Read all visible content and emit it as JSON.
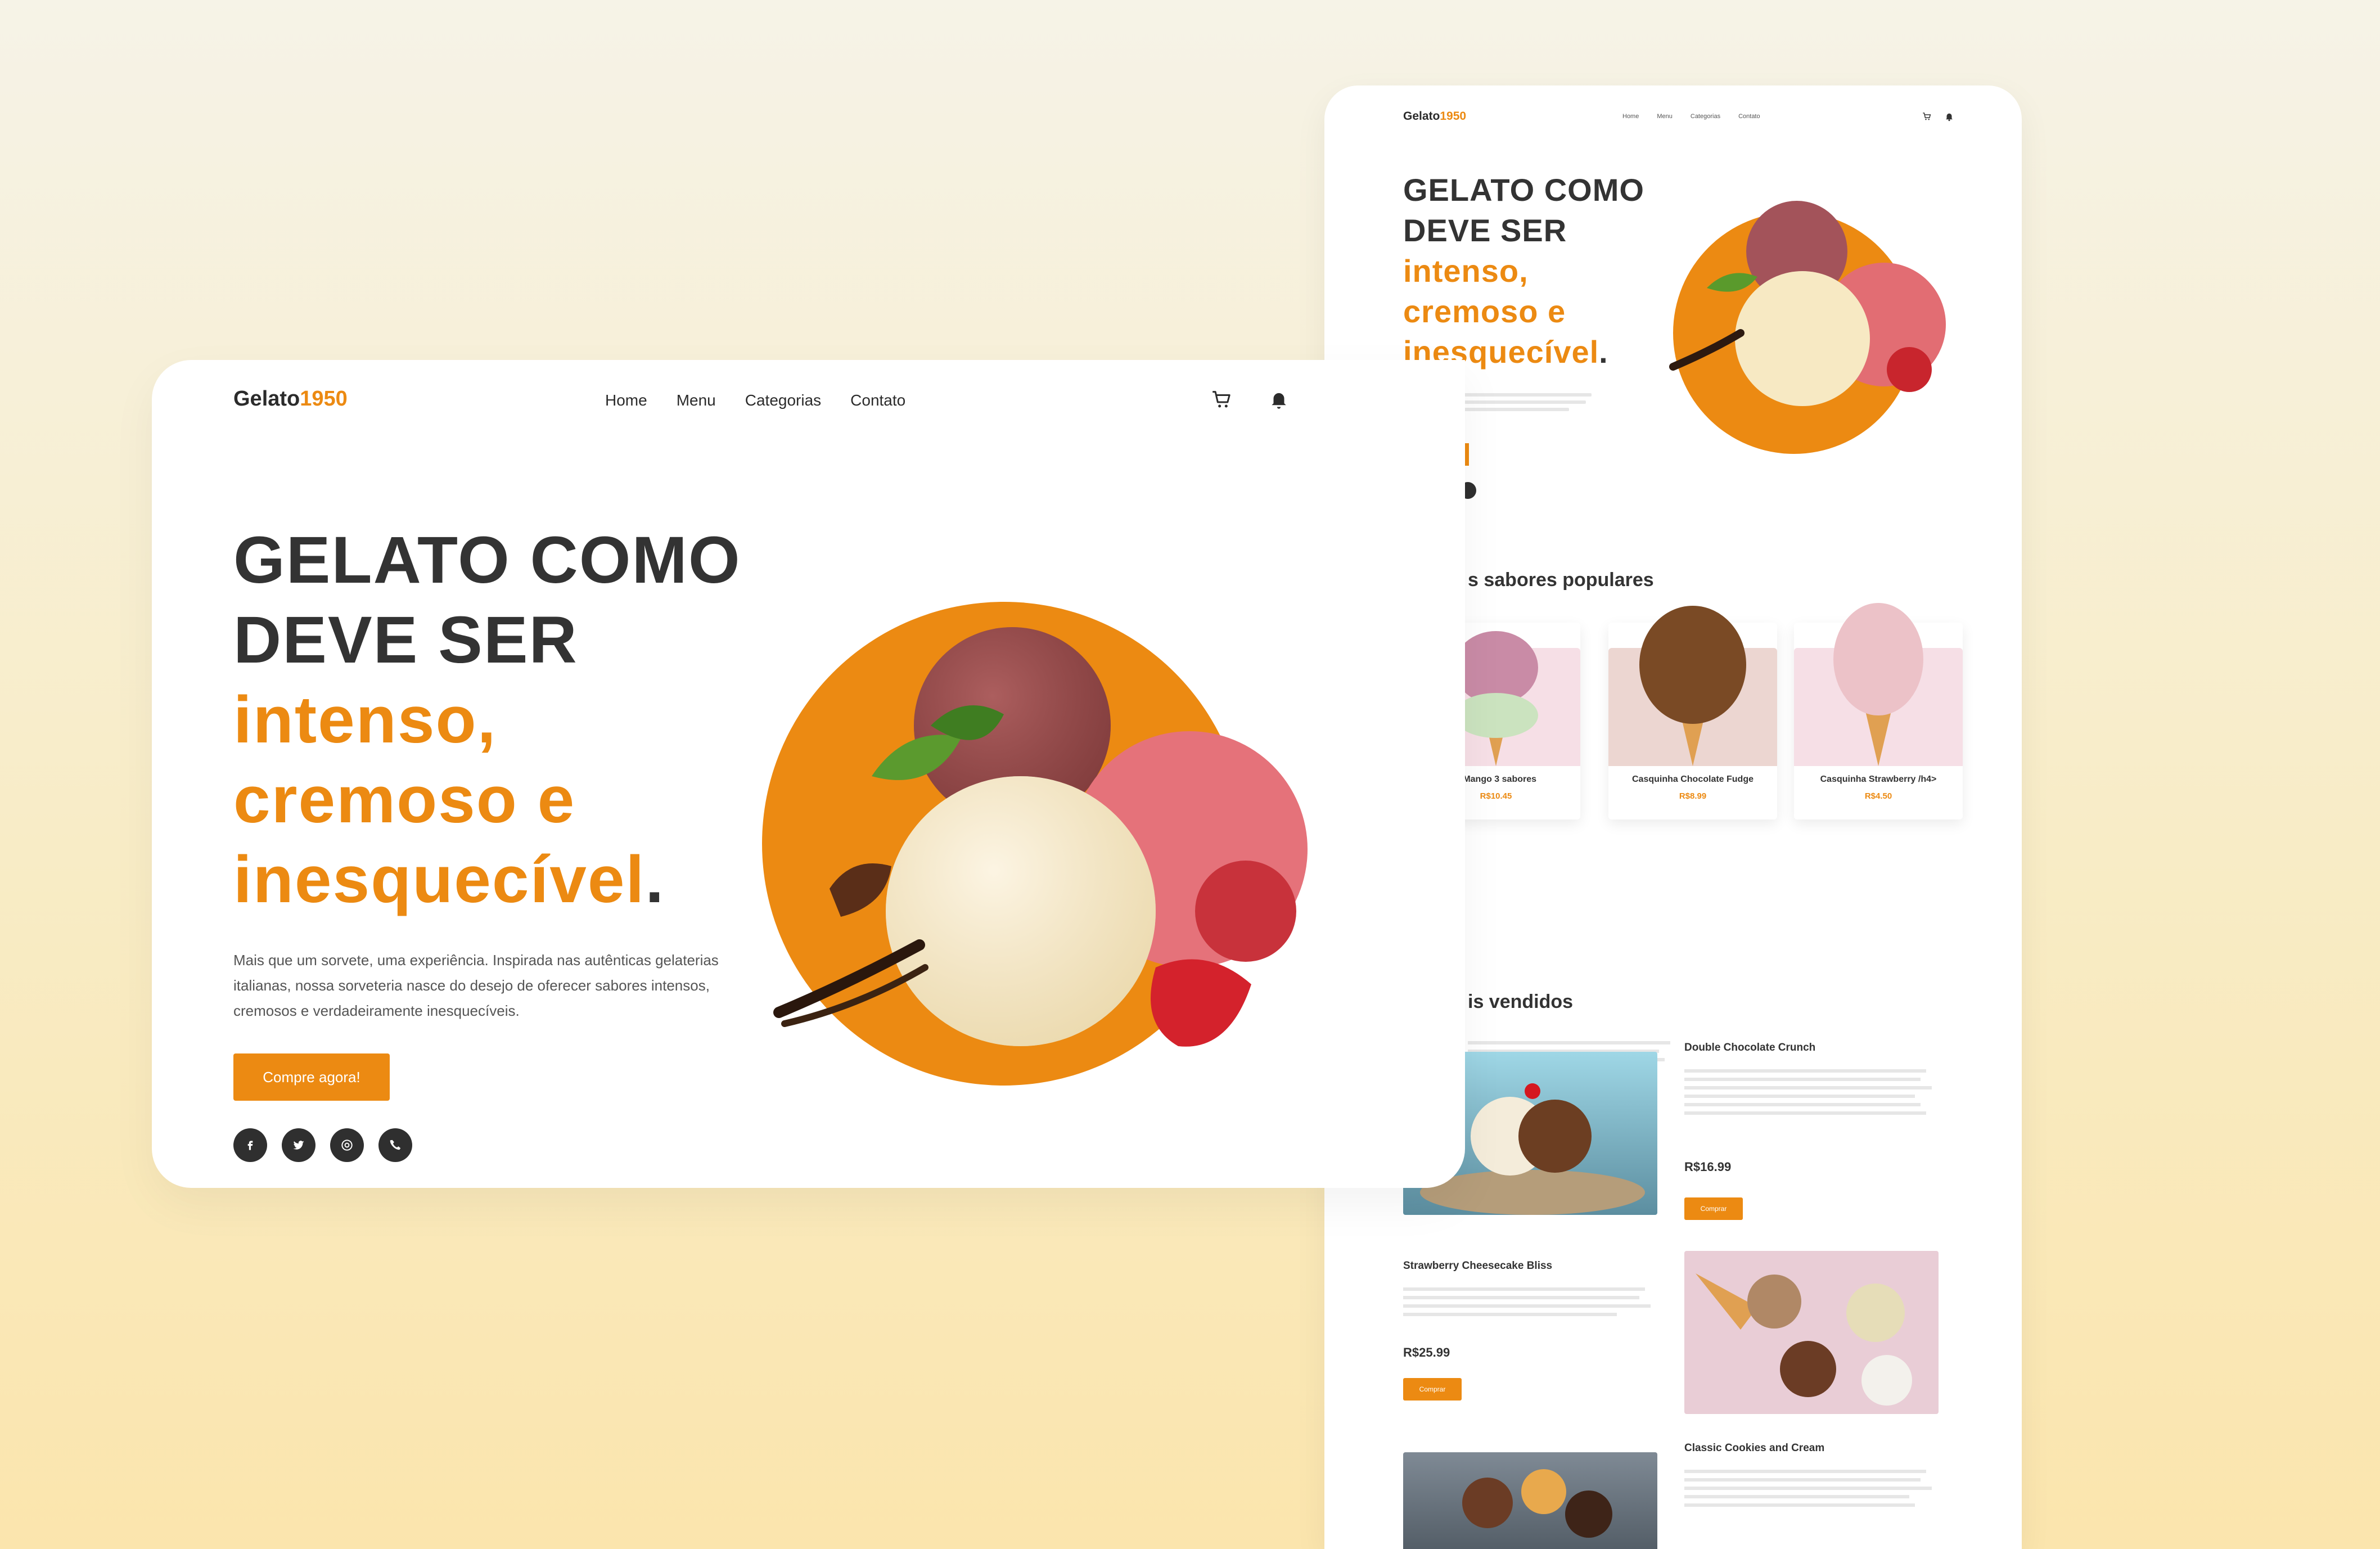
{
  "main": {
    "logo": {
      "text": "Gelato",
      "accent": "1950"
    },
    "nav": [
      "Home",
      "Menu",
      "Categorias",
      "Contato"
    ],
    "icons": [
      "cart-icon",
      "bell-icon"
    ],
    "hero": {
      "line1": "GELATO COMO",
      "line2": "DEVE SER",
      "accent1": "intenso,",
      "accent2": "cremoso e",
      "accent3": "inesquecível",
      "period": ".",
      "description": "Mais que um sorvete, uma experiência. Inspirada nas autênticas gelaterias italianas, nossa sorveteria nasce do desejo de oferecer sabores intensos, cremosos e verdadeiramente inesquecíveis.",
      "cta": "Compre agora!"
    },
    "social": [
      "facebook-icon",
      "twitter-icon",
      "instagram-icon",
      "phone-icon"
    ]
  },
  "secondary": {
    "logo": {
      "text": "Gelato",
      "accent": "1950"
    },
    "nav": [
      "Home",
      "Menu",
      "Categorias",
      "Contato"
    ],
    "hero": {
      "line1": "GELATO COMO",
      "line2": "DEVE SER",
      "accent1": "intenso,",
      "accent2": "cremoso e",
      "accent3": "inesquecível",
      "period": "."
    },
    "popular_title": "s sabores populares",
    "popular": [
      {
        "name": "a Mango 3 sabores",
        "price": "R$10.45"
      },
      {
        "name": "Casquinha Chocolate Fudge",
        "price": "R$8.99"
      },
      {
        "name": "Casquinha Strawberry /h4>",
        "price": "R$4.50"
      }
    ],
    "best_title": "is vendidos",
    "best": [
      {
        "name": "Double Chocolate Crunch",
        "price": "R$16.99",
        "button": "Comprar"
      },
      {
        "name": "Strawberry Cheesecake Bliss",
        "price": "R$25.99",
        "button": "Comprar"
      },
      {
        "name": "Classic Cookies and Cream"
      }
    ]
  },
  "colors": {
    "accent": "#ec8a12",
    "dark": "#2f2f2f",
    "text": "#333333"
  }
}
